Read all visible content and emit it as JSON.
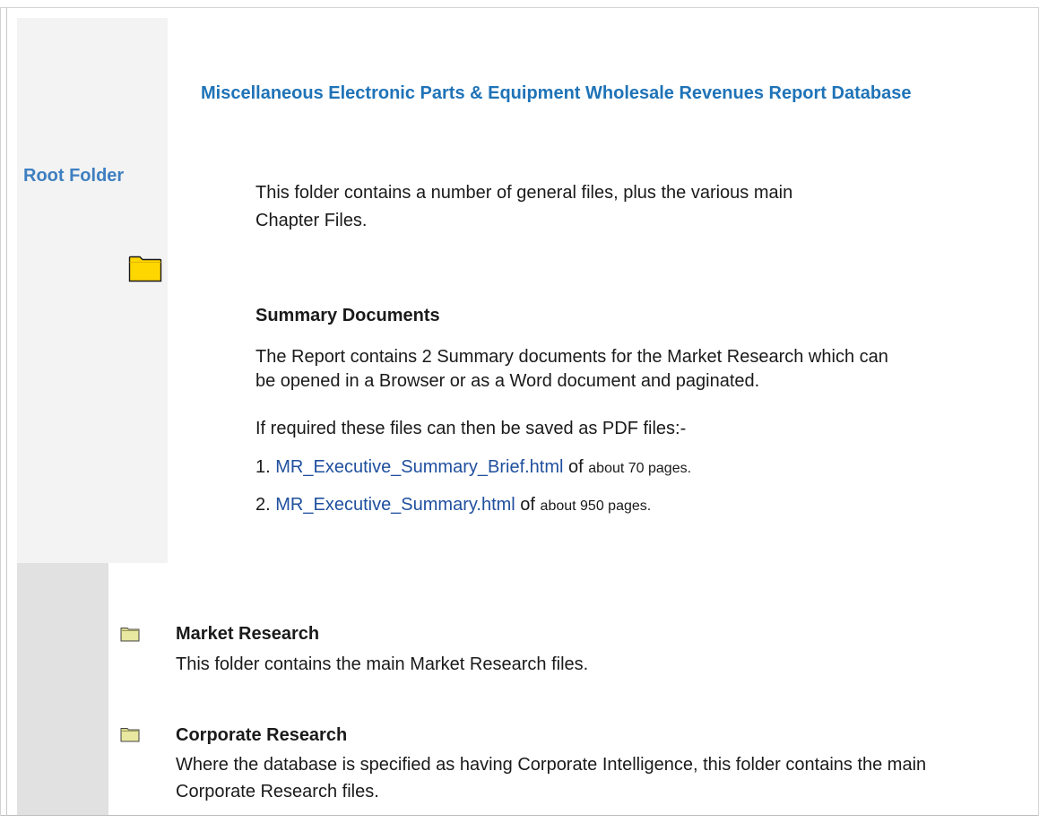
{
  "sidebar": {
    "root_label": "Root Folder"
  },
  "main": {
    "title": "Miscellaneous Electronic Parts & Equipment Wholesale Revenues Report Database",
    "intro": "This folder contains a number of general files, plus the various main Chapter Files.",
    "summary": {
      "heading": "Summary Documents",
      "description": "The Report contains 2 Summary documents for the Market Research which can be opened in a Browser or as a Word document and paginated.",
      "pdf_note": "If required these files can then be saved as PDF files:-",
      "documents": [
        {
          "number": "1.",
          "link": "MR_Executive_Summary_Brief.html",
          "suffix_a": "of",
          "suffix_b": "about 70 pages."
        },
        {
          "number": "2.",
          "link": "MR_Executive_Summary.html",
          "suffix_a": "of",
          "suffix_b": "about 950 pages."
        }
      ]
    }
  },
  "folders": [
    {
      "name": "Market Research",
      "description": "This folder contains the main Market Research files."
    },
    {
      "name": "Corporate Research",
      "description": "Where the database is specified as having Corporate Intelligence, this folder contains the main Corporate Research files."
    }
  ],
  "colors": {
    "title_blue": "#1f73b7",
    "root_label_blue": "#3e7fc1",
    "link_blue": "#1f4f9e",
    "folder_yellow": "#ffd700"
  },
  "icons": {
    "root_folder": "folder-icon",
    "sub_folder": "folder-icon"
  }
}
